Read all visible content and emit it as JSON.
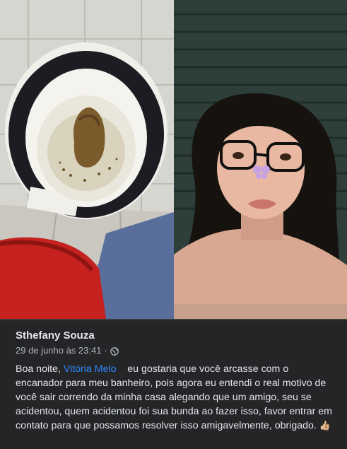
{
  "post": {
    "author": "Sthefany Souza",
    "timestamp": "29 de junho às 23:41",
    "separator": "·",
    "audience_icon": "globe-icon",
    "text_before_mention": "Boa noite,",
    "mention": "Vitória Melo",
    "text_after_mention": "eu gostaria que você arcasse com o encanador para meu banheiro, pois agora eu entendi o real motivo de você sair correndo da minha casa alegando que um amigo, seu se acidentou, quem acidentou foi sua bunda ao fazer isso, favor entrar em contato para que possamos resolver isso amigavelmente, obrigado.",
    "emoji": "👍🏼",
    "mention_color": "#2d88ff"
  },
  "photos": [
    {
      "icon": "toilet-photo"
    },
    {
      "icon": "selfie-photo"
    }
  ]
}
